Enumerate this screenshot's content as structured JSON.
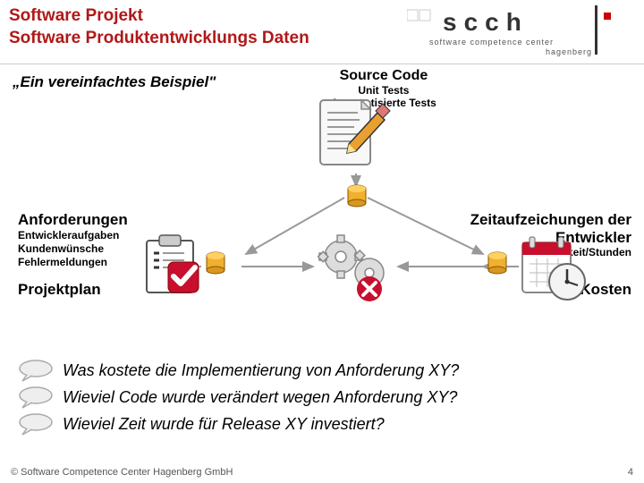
{
  "header": {
    "title_line1": "Software Projekt",
    "title_line2": "Software Produktentwicklungs Daten",
    "logo_text_main": "scch",
    "logo_text_sub1": "software competence center",
    "logo_text_sub2": "hagenberg"
  },
  "subtitle": "„Ein vereinfachtes Beispiel\"",
  "source": {
    "title": "Source Code",
    "sub1": "Unit Tests",
    "sub2": "Automatisierte Tests"
  },
  "requirements": {
    "title": "Anforderungen",
    "line1": "Entwickleraufgaben",
    "line2": "Kundenwünsche",
    "line3": "Fehlermeldungen"
  },
  "plan": "Projektplan",
  "time": {
    "title_line1": "Zeitaufzeichungen der",
    "title_line2": "Entwickler",
    "sub": "Tätigkeit/Stunden"
  },
  "cost": "Kosten",
  "questions": {
    "q1": "Was kostete die Implementierung von Anforderung XY?",
    "q2": "Wieviel Code wurde verändert wegen Anforderung XY?",
    "q3": "Wieviel Zeit wurde für Release XY investiert?"
  },
  "footer": {
    "copyright": "© Software Competence Center Hagenberg  GmbH",
    "page": "4"
  }
}
